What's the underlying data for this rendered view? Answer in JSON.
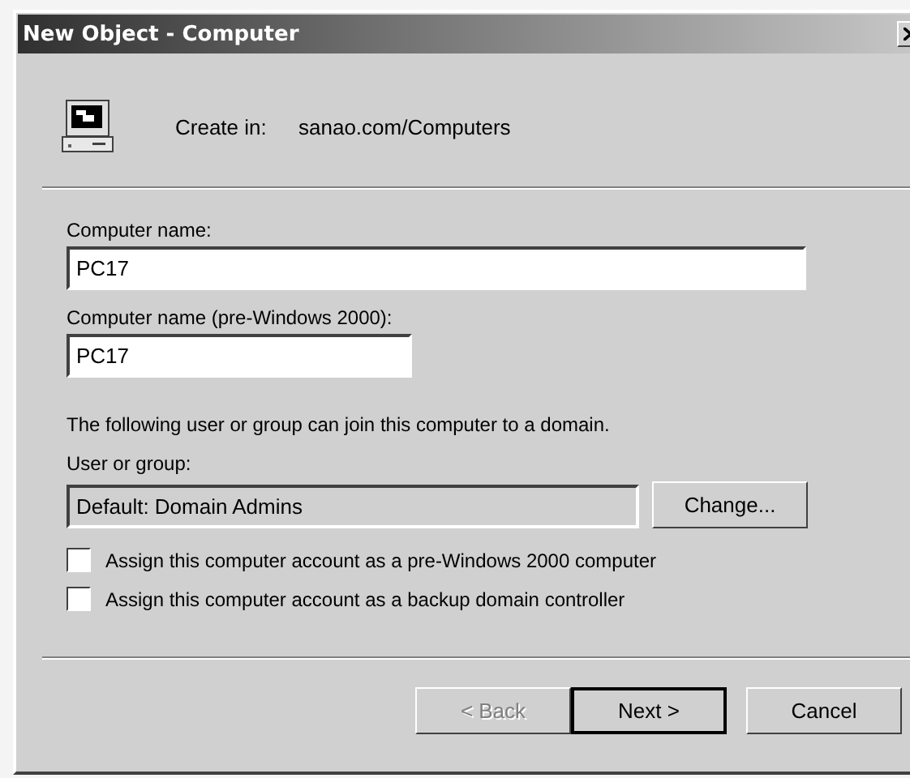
{
  "window": {
    "title": "New Object - Computer"
  },
  "header": {
    "label": "Create in:",
    "path": "sanao.com/Computers"
  },
  "fields": [
    {
      "label": "Computer name:",
      "value": "PC17",
      "disabled": false
    },
    {
      "label": "Computer name (pre-Windows 2000):",
      "value": "PC17",
      "disabled": false
    }
  ],
  "note": "The following user or group can join this computer to a domain.",
  "user_group": {
    "label": "User or group:",
    "value": "Default: Domain Admins",
    "disabled": true,
    "button": {
      "label": "Change..."
    }
  },
  "options": [
    {
      "label": "Assign this computer account as a pre-Windows 2000 computer",
      "checked": false
    },
    {
      "label": "Assign this computer account as a backup domain controller",
      "checked": false
    }
  ],
  "buttons": [
    {
      "label": "< Back",
      "disabled": true,
      "default": false
    },
    {
      "label": "Next >",
      "disabled": false,
      "default": true
    },
    {
      "label": "Cancel",
      "disabled": false,
      "default": false
    }
  ]
}
